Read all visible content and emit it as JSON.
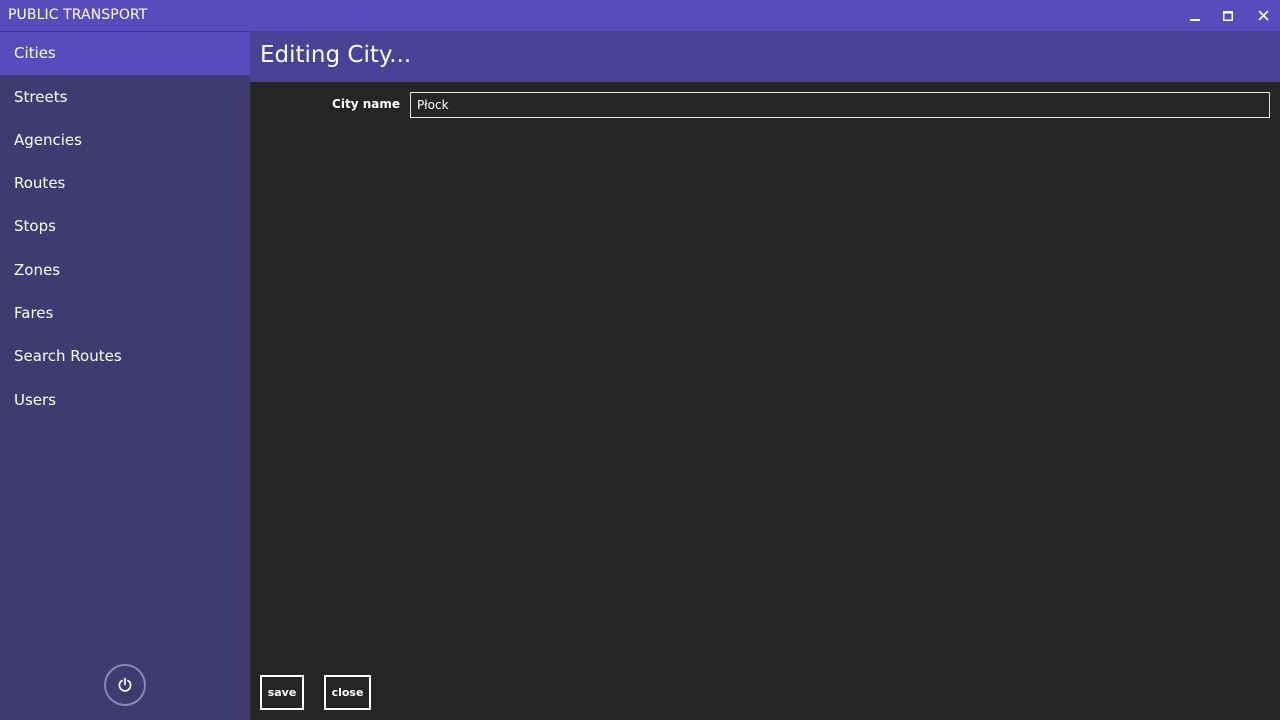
{
  "window": {
    "title": "PUBLIC TRANSPORT",
    "controls": [
      {
        "name": "minimize-icon"
      },
      {
        "name": "maximize-icon"
      },
      {
        "name": "close-icon"
      }
    ]
  },
  "sidebar": {
    "items": [
      {
        "label": "Cities",
        "active": true
      },
      {
        "label": "Streets"
      },
      {
        "label": "Agencies"
      },
      {
        "label": "Routes"
      },
      {
        "label": "Stops"
      },
      {
        "label": "Zones"
      },
      {
        "label": "Fares"
      },
      {
        "label": "Search Routes"
      },
      {
        "label": "Users"
      }
    ],
    "power_icon": "power-icon"
  },
  "main": {
    "title": "Editing City...",
    "form": {
      "city_name_label": "City name",
      "city_name_value": "Płock"
    },
    "actions": {
      "save_label": "save",
      "close_label": "close"
    }
  },
  "colors": {
    "titlebar": "#5a4bbd",
    "sidebar": "#3f3a70",
    "active_item": "#5a4bbd",
    "header": "#4a4296",
    "content_bg": "#252525"
  }
}
